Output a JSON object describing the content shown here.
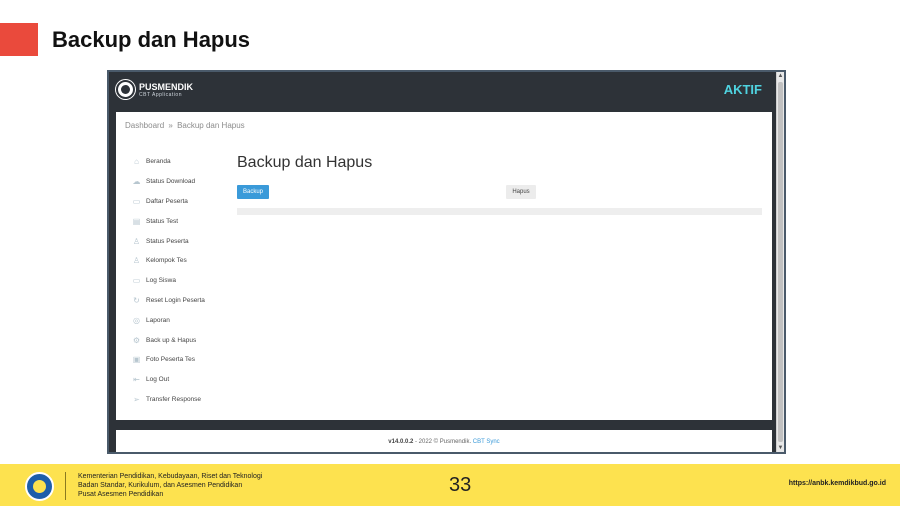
{
  "slide": {
    "title": "Backup dan Hapus",
    "page_number": "33",
    "url": "https://anbk.kemdikbud.go.id",
    "org_lines": [
      "Kementerian Pendidikan, Kebudayaan, Riset dan Teknologi",
      "Badan Standar, Kurikulum, dan Asesmen Pendidikan",
      "Pusat Asesmen Pendidikan"
    ]
  },
  "app": {
    "brand_name": "PUSMENDIK",
    "brand_sub": "CBT Application",
    "status": "AKTIF",
    "breadcrumb": {
      "home": "Dashboard",
      "sep": "»",
      "current": "Backup dan Hapus"
    },
    "heading": "Backup dan Hapus",
    "buttons": {
      "backup": "Backup",
      "hapus": "Hapus"
    },
    "sidebar": [
      {
        "label": "Beranda",
        "icon": "home-icon",
        "glyph": "⌂"
      },
      {
        "label": "Status Download",
        "icon": "cloud-icon",
        "glyph": "☁"
      },
      {
        "label": "Daftar Peserta",
        "icon": "folder-icon",
        "glyph": "▭"
      },
      {
        "label": "Status Test",
        "icon": "clipboard-icon",
        "glyph": "▤"
      },
      {
        "label": "Status Peserta",
        "icon": "user-icon",
        "glyph": "♙"
      },
      {
        "label": "Kelompok Tes",
        "icon": "users-icon",
        "glyph": "♙"
      },
      {
        "label": "Log Siswa",
        "icon": "folder-icon",
        "glyph": "▭"
      },
      {
        "label": "Reset Login Peserta",
        "icon": "refresh-icon",
        "glyph": "↻"
      },
      {
        "label": "Laporan",
        "icon": "globe-icon",
        "glyph": "◎"
      },
      {
        "label": "Back up & Hapus",
        "icon": "settings-icon",
        "glyph": "⚙"
      },
      {
        "label": "Foto Peserta Tes",
        "icon": "image-icon",
        "glyph": "▣"
      },
      {
        "label": "Log Out",
        "icon": "logout-icon",
        "glyph": "⇤"
      },
      {
        "label": "Transfer Response",
        "icon": "send-icon",
        "glyph": "➢"
      }
    ],
    "footer": {
      "version": "v14.0.0.2",
      "text": " - 2022 © Pusmendik. ",
      "link": "CBT Sync"
    }
  }
}
